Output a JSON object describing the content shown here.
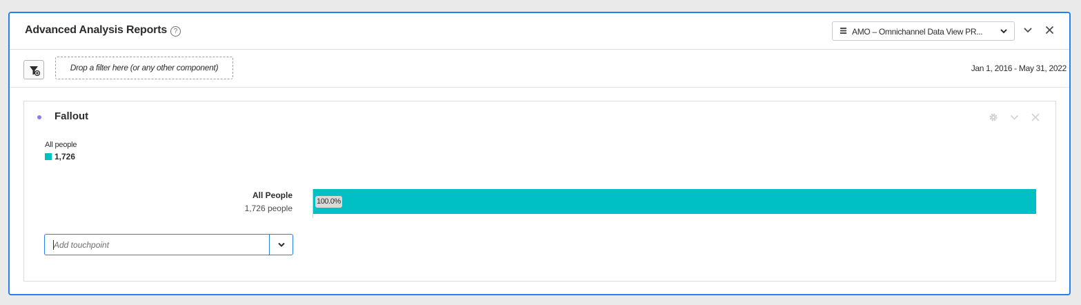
{
  "header": {
    "title": "Advanced Analysis Reports",
    "help_glyph": "?",
    "data_view_label": "AMO – Omnichannel Data View PR...",
    "icons": [
      "help-icon",
      "database-icon",
      "chevron-down-icon",
      "close-icon"
    ]
  },
  "filterbar": {
    "drop_zone_text": "Drop a filter here (or any other component)",
    "date_range": "Jan 1, 2016 - May 31, 2022",
    "icons": [
      "add-filter-icon"
    ]
  },
  "panel": {
    "title": "Fallout",
    "accent_color": "#8a7de8",
    "legend": {
      "label": "All people",
      "value": "1,726",
      "color": "#00bfc5"
    },
    "rows": [
      {
        "name": "All People",
        "count_text": "1,726 people",
        "percent_text": "100.0%",
        "fraction": 1.0,
        "color": "#00bfc5"
      }
    ],
    "touchpoint": {
      "placeholder": "Add touchpoint"
    },
    "icons": [
      "gear-icon",
      "chevron-down-icon",
      "close-icon"
    ]
  },
  "colors": {
    "focus_border": "#2680eb",
    "bar": "#00bfc5"
  }
}
